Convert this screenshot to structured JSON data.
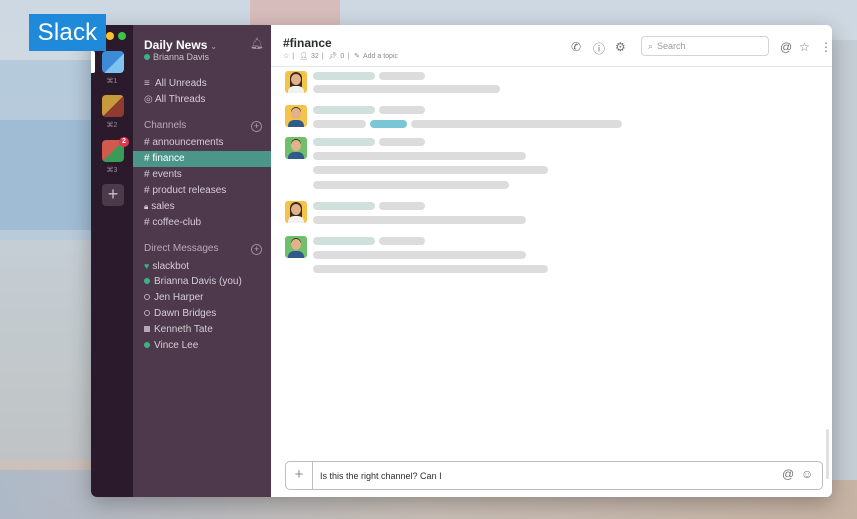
{
  "badge": {
    "label": "Slack"
  },
  "colors": {
    "sidebar": "#4d394b",
    "rail": "#2b1a2b",
    "active_channel": "#4c9689",
    "accent": "#1f8ad9",
    "presence": "#38b486",
    "notification": "#e0364f"
  },
  "rail": {
    "shortcuts": [
      "⌘1",
      "⌘2",
      "⌘3"
    ],
    "notification_count": "2",
    "add_icon": "plus-icon"
  },
  "sidebar": {
    "team_name": "Daily News",
    "user": "Brianna Davis",
    "all_unreads": "All Unreads",
    "all_threads": "All Threads",
    "channels_header": "Channels",
    "channels": [
      {
        "label": "announcements",
        "prefix": "#"
      },
      {
        "label": "finance",
        "prefix": "#",
        "active": true
      },
      {
        "label": "events",
        "prefix": "#"
      },
      {
        "label": "product releases",
        "prefix": "#"
      },
      {
        "label": "sales",
        "prefix": "🔒"
      },
      {
        "label": "coffee-club",
        "prefix": "#"
      }
    ],
    "dm_header": "Direct Messages",
    "dms": [
      {
        "label": "slackbot",
        "status": "bot"
      },
      {
        "label": "Brianna Davis (you)",
        "status": "online"
      },
      {
        "label": "Jen Harper",
        "status": "away"
      },
      {
        "label": "Dawn Bridges",
        "status": "away"
      },
      {
        "label": "Kenneth Tate",
        "status": "group"
      },
      {
        "label": "Vince Lee",
        "status": "online"
      }
    ]
  },
  "channel": {
    "name": "#finance",
    "members": "32",
    "pins": "0",
    "add_topic": "Add a topic"
  },
  "header": {
    "search_placeholder": "Search"
  },
  "composer": {
    "value": "Is this the right channel? Can I"
  }
}
